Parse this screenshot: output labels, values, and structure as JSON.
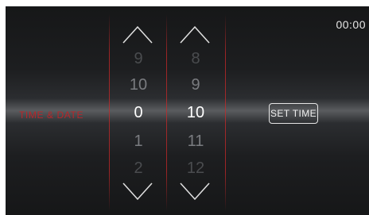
{
  "clock": {
    "time": "00:00"
  },
  "section": {
    "label": "TIME & DATE"
  },
  "hour_picker": {
    "values": [
      "9",
      "10",
      "0",
      "1",
      "2"
    ],
    "selected": "0"
  },
  "minute_picker": {
    "values": [
      "8",
      "9",
      "10",
      "11",
      "12"
    ],
    "selected": "10"
  },
  "actions": {
    "set_time_label": "SET TIME"
  },
  "icons": {
    "increment": "chevron-up-icon",
    "decrement": "chevron-down-icon"
  },
  "colors": {
    "accent": "#b6262a",
    "text": "#ffffff",
    "dim": "#4a4c4f"
  }
}
